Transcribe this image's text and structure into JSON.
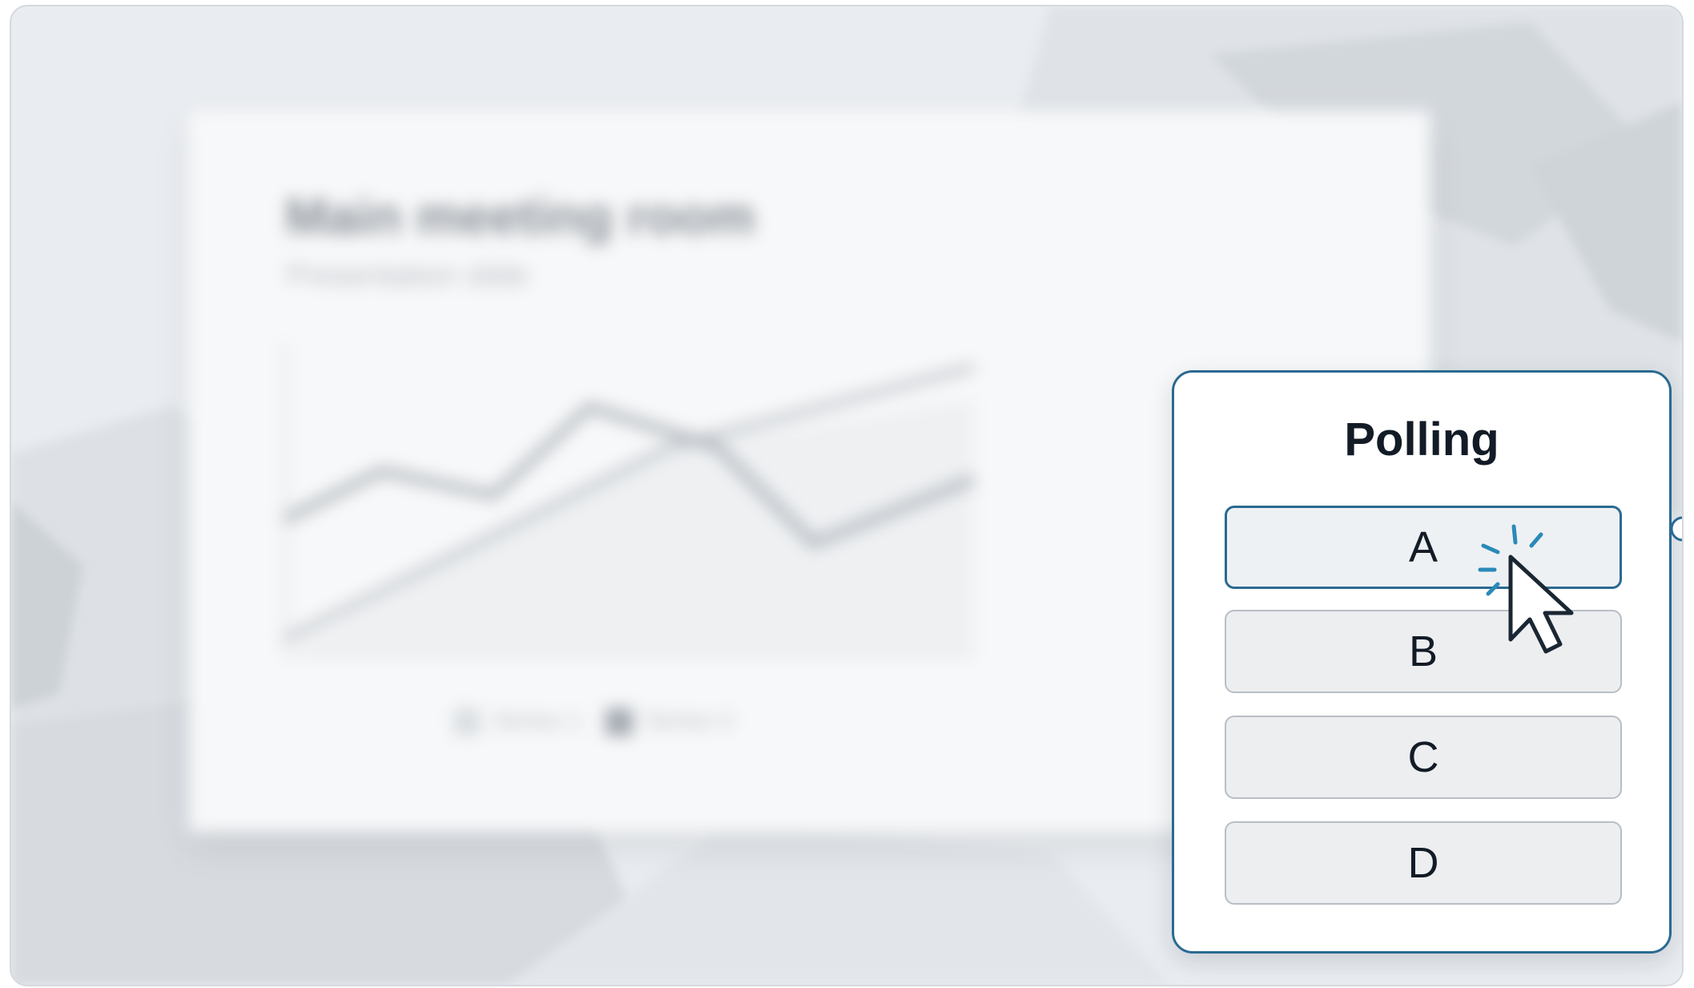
{
  "background_slide": {
    "title": "Main meeting room",
    "subtitle": "Presentation slide",
    "legend": [
      {
        "label": "Series 1",
        "color": "#d9dde1"
      },
      {
        "label": "Series 2",
        "color": "#9fa6ae"
      }
    ]
  },
  "poll": {
    "title": "Polling",
    "options": [
      {
        "label": "A",
        "selected": true
      },
      {
        "label": "B",
        "selected": false
      },
      {
        "label": "C",
        "selected": false
      },
      {
        "label": "D",
        "selected": false
      }
    ]
  },
  "colors": {
    "accent": "#2a6a92",
    "option_bg": "#eceef0",
    "background": "#e9ecf0"
  },
  "icons": {
    "cursor": "mouse-pointer-icon",
    "click_burst": "click-burst-icon",
    "connector": "connector-dot-icon"
  }
}
